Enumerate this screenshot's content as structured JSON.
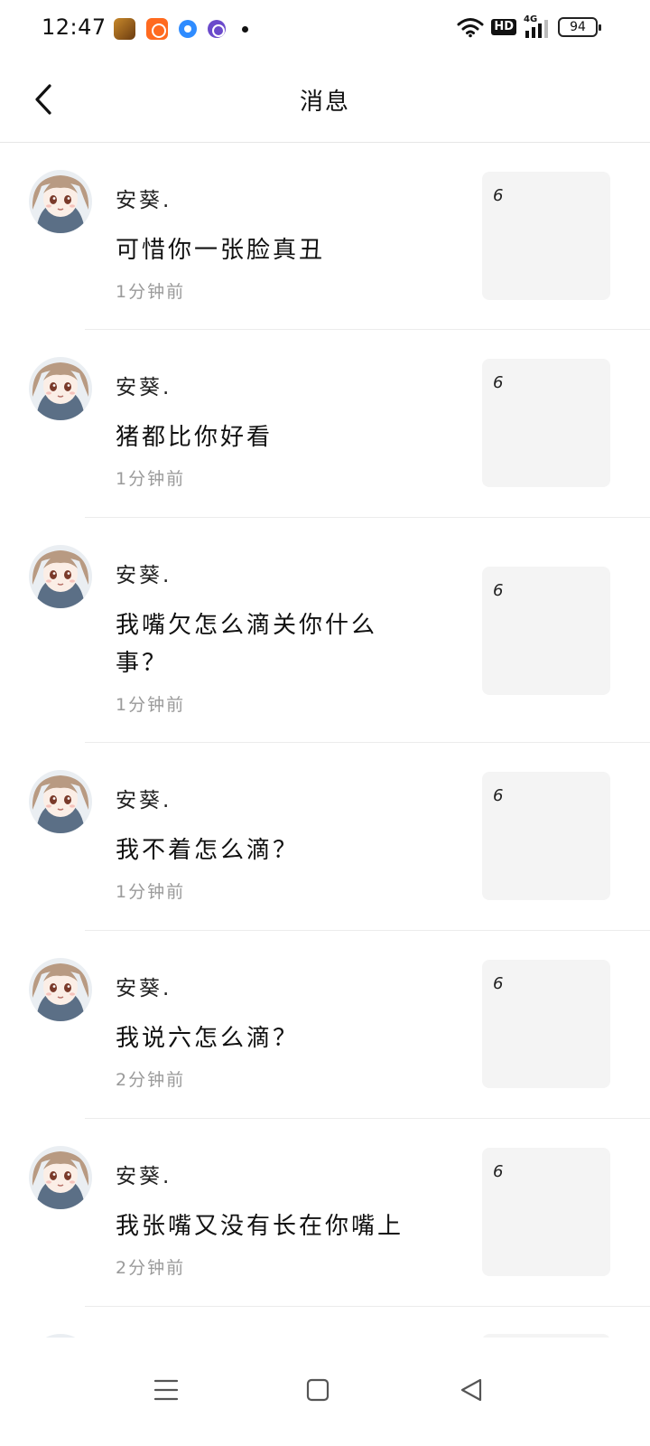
{
  "status_bar": {
    "time": "12:47",
    "network_badge": "HD",
    "network_type": "4G",
    "battery": "94"
  },
  "header": {
    "title": "消息"
  },
  "messages": [
    {
      "name": "安葵.",
      "content": "可惜你一张脸真丑",
      "time": "1分钟前",
      "thumb_text": "6"
    },
    {
      "name": "安葵.",
      "content": "猪都比你好看",
      "time": "1分钟前",
      "thumb_text": "6"
    },
    {
      "name": "安葵.",
      "content": "我嘴欠怎么滴关你什么事？",
      "time": "1分钟前",
      "thumb_text": "6"
    },
    {
      "name": "安葵.",
      "content": "我不着怎么滴？",
      "time": "1分钟前",
      "thumb_text": "6"
    },
    {
      "name": "安葵.",
      "content": "我说六怎么滴？",
      "time": "2分钟前",
      "thumb_text": "6"
    },
    {
      "name": "安葵.",
      "content": "我张嘴又没有长在你嘴上",
      "time": "2分钟前",
      "thumb_text": "6"
    }
  ]
}
